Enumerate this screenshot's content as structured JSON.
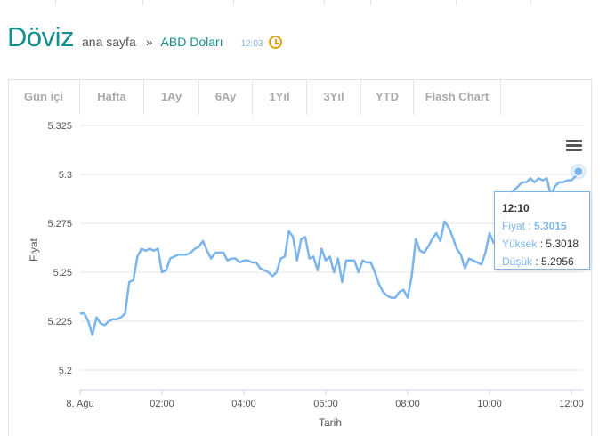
{
  "header": {
    "logo": "Döviz",
    "breadcrumb_home": "ana sayfa",
    "breadcrumb_separator": "»",
    "breadcrumb_current": "ABD Doları",
    "time": "12:03"
  },
  "tabs": [
    "Gün içi",
    "Hafta",
    "1Ay",
    "6Ay",
    "1Yıl",
    "3Yıl",
    "YTD",
    "Flash Chart"
  ],
  "tooltip": {
    "time": "12:10",
    "price_label": "Fiyat",
    "price_value": "5.3015",
    "high_label": "Yüksek",
    "high_value": "5.3018",
    "low_label": "Düşük",
    "low_value": "5.2956"
  },
  "colors": {
    "accent": "#178f8f",
    "line": "#7cb5ec",
    "clock": "#e0a300"
  },
  "chart_data": {
    "type": "line",
    "xlabel": "Tarih",
    "ylabel": "Fiyat",
    "ylim": [
      5.19,
      5.33
    ],
    "yticks": [
      "5.2",
      "5.225",
      "5.25",
      "5.275",
      "5.3",
      "5.325"
    ],
    "xticks": [
      "8. Ağu",
      "02:00",
      "04:00",
      "06:00",
      "08:00",
      "10:00",
      "12:00"
    ],
    "grid": true,
    "series": [
      {
        "name": "",
        "x": [
          0,
          0.1,
          0.2,
          0.3,
          0.4,
          0.5,
          0.6,
          0.7,
          0.8,
          0.9,
          1.0,
          1.1,
          1.2,
          1.3,
          1.4,
          1.5,
          1.6,
          1.7,
          1.8,
          1.9,
          2.0,
          2.1,
          2.2,
          2.3,
          2.4,
          2.5,
          2.6,
          2.7,
          2.8,
          2.9,
          3.0,
          3.1,
          3.2,
          3.3,
          3.4,
          3.5,
          3.6,
          3.7,
          3.8,
          3.9,
          4.0,
          4.1,
          4.2,
          4.3,
          4.4,
          4.5,
          4.6,
          4.7,
          4.8,
          4.9,
          5.0,
          5.1,
          5.2,
          5.3,
          5.4,
          5.5,
          5.6,
          5.7,
          5.8,
          5.9,
          6.0,
          6.1,
          6.2,
          6.3,
          6.4,
          6.5,
          6.6,
          6.7,
          6.8,
          6.9,
          7.0,
          7.1,
          7.2,
          7.3,
          7.4,
          7.5,
          7.6,
          7.7,
          7.8,
          7.9,
          8.0,
          8.1,
          8.2,
          8.3,
          8.4,
          8.5,
          8.6,
          8.7,
          8.8,
          8.9,
          9.0,
          9.1,
          9.2,
          9.3,
          9.4,
          9.5,
          9.6,
          9.7,
          9.8,
          9.9,
          10.0,
          10.1,
          10.2,
          10.3,
          10.4,
          10.5,
          10.6,
          10.7,
          10.8,
          10.9,
          11.0,
          11.1,
          11.2,
          11.3,
          11.4,
          11.5,
          11.6,
          11.7,
          11.8,
          11.9,
          12.0,
          12.1,
          12.17
        ],
        "values": [
          5.229,
          5.229,
          5.225,
          5.218,
          5.227,
          5.224,
          5.223,
          5.225,
          5.226,
          5.226,
          5.227,
          5.229,
          5.245,
          5.246,
          5.258,
          5.262,
          5.261,
          5.262,
          5.261,
          5.262,
          5.25,
          5.251,
          5.257,
          5.258,
          5.259,
          5.259,
          5.259,
          5.26,
          5.262,
          5.263,
          5.266,
          5.261,
          5.257,
          5.26,
          5.26,
          5.26,
          5.256,
          5.257,
          5.257,
          5.255,
          5.256,
          5.256,
          5.255,
          5.255,
          5.252,
          5.251,
          5.25,
          5.248,
          5.25,
          5.257,
          5.258,
          5.271,
          5.268,
          5.256,
          5.267,
          5.268,
          5.257,
          5.258,
          5.251,
          5.262,
          5.256,
          5.258,
          5.25,
          5.257,
          5.245,
          5.256,
          5.256,
          5.256,
          5.25,
          5.256,
          5.255,
          5.255,
          5.25,
          5.244,
          5.24,
          5.238,
          5.237,
          5.237,
          5.24,
          5.241,
          5.237,
          5.248,
          5.267,
          5.261,
          5.26,
          5.263,
          5.267,
          5.27,
          5.266,
          5.276,
          5.273,
          5.268,
          5.262,
          5.259,
          5.252,
          5.257,
          5.256,
          5.255,
          5.254,
          5.26,
          5.27,
          5.265,
          5.268,
          5.272,
          5.286,
          5.289,
          5.292,
          5.294,
          5.296,
          5.296,
          5.298,
          5.296,
          5.298,
          5.297,
          5.298,
          5.289,
          5.294,
          5.296,
          5.296,
          5.297,
          5.297,
          5.299,
          5.3015
        ]
      }
    ]
  }
}
